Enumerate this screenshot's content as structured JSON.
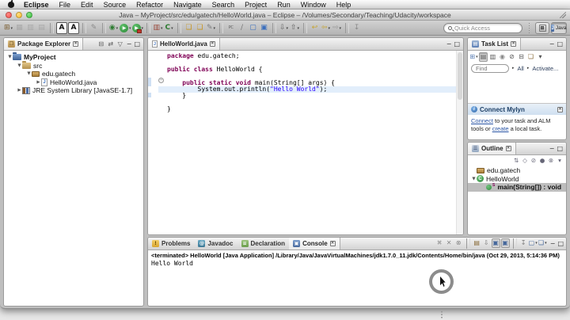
{
  "ui": {
    "close_glyph": "✕",
    "min_glyph": "−",
    "max_glyph": "□",
    "dd_glyph": "▾",
    "tri_glyph": "▸",
    "fold_minus": "−"
  },
  "menu_bar": {
    "items": [
      {
        "label": "Eclipse",
        "bold": true
      },
      {
        "label": "File"
      },
      {
        "label": "Edit"
      },
      {
        "label": "Source"
      },
      {
        "label": "Refactor"
      },
      {
        "label": "Navigate"
      },
      {
        "label": "Search"
      },
      {
        "label": "Project"
      },
      {
        "label": "Run"
      },
      {
        "label": "Window"
      },
      {
        "label": "Help"
      }
    ]
  },
  "titlebar": {
    "title": "Java – MyProject/src/edu/gatech/HelloWorld.java – Eclipse – /Volumes/Secondary/Teaching/Udacity/workspace"
  },
  "toolbar": {
    "quick_access_placeholder": "Quick Access",
    "perspective_label": "Java",
    "perspective_icon_letter": "J",
    "open_perspective_glyph": "⊞",
    "icons": [
      {
        "name": "new-wizard-icon",
        "glyph": "⊞",
        "c": "#7a5c2e",
        "dd": true
      },
      {
        "name": "save-icon",
        "glyph": "▦",
        "c": "#a8a8a8"
      },
      {
        "name": "save-all-icon",
        "glyph": "▥",
        "c": "#a8a8a8"
      },
      {
        "name": "print-icon",
        "glyph": "▤",
        "c": "#a8a8a8"
      },
      {
        "sep": true
      },
      {
        "name": "font-decrease-icon",
        "glyph": "A",
        "style": "boxed"
      },
      {
        "name": "font-increase-icon",
        "glyph": "A",
        "style": "boxed"
      },
      {
        "sep": true
      },
      {
        "name": "skip-breakpoints-icon",
        "glyph": "✎",
        "c": "#8a8a8a"
      },
      {
        "sep": true
      },
      {
        "name": "debug-icon",
        "glyph": "◉",
        "c": "#2e7d32",
        "dd": true
      },
      {
        "name": "run-icon",
        "glyph": "▶",
        "style": "green-circle",
        "dd": true
      },
      {
        "name": "external-tools-icon",
        "glyph": "▶",
        "style": "green-circle-red",
        "dd": true
      },
      {
        "sep": true
      },
      {
        "name": "coverage-icon",
        "glyph": "▥",
        "c": "#9c4a3c",
        "dd": true
      },
      {
        "name": "checkout-icon",
        "glyph": "C",
        "c": "#2e7d32",
        "style": "bold",
        "dd": true
      },
      {
        "sep": true
      },
      {
        "name": "open-folder-icon",
        "glyph": "❏",
        "c": "#c8951f"
      },
      {
        "name": "open-folder-alt-icon",
        "glyph": "❏",
        "c": "#c8951f"
      },
      {
        "name": "new-java-element-icon",
        "glyph": "✎",
        "c": "#7d7d7d",
        "dd": true
      },
      {
        "sep": true
      },
      {
        "name": "pc-icon",
        "glyph": "PC",
        "c": "#666666",
        "style": "small"
      },
      {
        "name": "mark-occurrences-icon",
        "glyph": "∕",
        "c": "#777777"
      },
      {
        "name": "open-type-icon",
        "glyph": "▢",
        "c": "#3b6fbd"
      },
      {
        "name": "open-task-icon",
        "glyph": "▣",
        "c": "#3b6fbd"
      },
      {
        "sep": true
      },
      {
        "name": "next-annotation-icon",
        "glyph": "⇩",
        "c": "#666666",
        "dd": true
      },
      {
        "name": "previous-annotation-icon",
        "glyph": "⇧",
        "c": "#666666",
        "dd": true
      },
      {
        "sep": true
      },
      {
        "name": "last-edit-location-icon",
        "glyph": "↩",
        "c": "#c7a42e"
      },
      {
        "name": "back-icon",
        "glyph": "⇦",
        "c": "#c7a42e",
        "dd": true
      },
      {
        "name": "forward-icon",
        "glyph": "⇨",
        "c": "#9a9a9a",
        "dd": true
      },
      {
        "sep": true
      },
      {
        "name": "pin-editor-icon",
        "glyph": "↧",
        "c": "#8a8a8a"
      }
    ]
  },
  "package_explorer": {
    "title": "Package Explorer",
    "toolbar": [
      {
        "name": "collapse-all-icon",
        "glyph": "⊟"
      },
      {
        "name": "link-with-editor-icon",
        "glyph": "⇄"
      },
      {
        "name": "view-menu-icon",
        "glyph": "▽"
      }
    ],
    "tree": [
      {
        "label": "MyProject",
        "icon": "project",
        "arrow": "down",
        "indent": 0,
        "bold": true
      },
      {
        "label": "src",
        "icon": "src-folder",
        "arrow": "down",
        "indent": 1
      },
      {
        "label": "edu.gatech",
        "icon": "package",
        "arrow": "down",
        "indent": 2
      },
      {
        "label": "HelloWorld.java",
        "icon": "java-file",
        "arrow": "right",
        "indent": 3
      },
      {
        "label": "JRE System Library [JavaSE-1.7]",
        "icon": "library",
        "arrow": "right",
        "indent": 1
      }
    ]
  },
  "editor": {
    "tab": "HelloWorld.java",
    "lines": [
      {
        "tokens": [
          [
            "kw",
            "package"
          ],
          [
            "pl",
            " edu.gatech;"
          ]
        ]
      },
      {
        "tokens": []
      },
      {
        "tokens": [
          [
            "kw",
            "public"
          ],
          [
            "pl",
            " "
          ],
          [
            "kw",
            "class"
          ],
          [
            "pl",
            " HelloWorld {"
          ]
        ]
      },
      {
        "tokens": []
      },
      {
        "tokens": [
          [
            "pl",
            "    "
          ],
          [
            "kw",
            "public"
          ],
          [
            "pl",
            " "
          ],
          [
            "kw",
            "static"
          ],
          [
            "pl",
            " "
          ],
          [
            "kw",
            "void"
          ],
          [
            "pl",
            " main(String[] args) {"
          ]
        ],
        "fold": true
      },
      {
        "tokens": [
          [
            "pl",
            "        System.out.println("
          ],
          [
            "str",
            "\"Hello World\""
          ],
          [
            "pl",
            ");"
          ]
        ],
        "highlight": true
      },
      {
        "tokens": [
          [
            "pl",
            "    }"
          ]
        ]
      },
      {
        "tokens": []
      },
      {
        "tokens": [
          [
            "pl",
            "}"
          ]
        ]
      }
    ]
  },
  "task_list": {
    "title": "Task List",
    "toolbar": [
      {
        "name": "new-task-icon",
        "glyph": "⊞",
        "c": "#5b7fb5",
        "dd": true
      },
      {
        "name": "categorized-presentation-icon",
        "glyph": "▤",
        "pressed": true
      },
      {
        "name": "scheduled-presentation-icon",
        "glyph": "▥"
      },
      {
        "name": "focus-on-workweek-icon",
        "glyph": "◉",
        "c": "#888888"
      },
      {
        "name": "filter-completed-icon",
        "glyph": "⊘"
      },
      {
        "name": "collapse-all-icon",
        "glyph": "⊟"
      },
      {
        "name": "task-repositories-icon",
        "glyph": "❏",
        "c": "#8a6d3b"
      },
      {
        "name": "view-menu-icon",
        "glyph": "▾"
      }
    ],
    "find_placeholder": "Find",
    "all_label": "All",
    "activate_label": "Activate...",
    "mylyn": {
      "title": "Connect Mylyn",
      "body_parts": [
        {
          "t": "Connect",
          "link": true
        },
        {
          "t": " to your task and ALM tools or "
        },
        {
          "t": "create",
          "link": true
        },
        {
          "t": " a local task."
        }
      ]
    }
  },
  "outline": {
    "title": "Outline",
    "toolbar": [
      {
        "name": "sort-icon",
        "glyph": "⇅"
      },
      {
        "name": "hide-fields-icon",
        "glyph": "◇"
      },
      {
        "name": "hide-static-members-icon",
        "glyph": "⊘"
      },
      {
        "name": "hide-non-public-members-icon",
        "glyph": "●"
      },
      {
        "name": "hide-local-types-icon",
        "glyph": "⊗"
      },
      {
        "name": "view-menu-icon",
        "glyph": "▾"
      }
    ],
    "items": [
      {
        "label": "edu.gatech",
        "icon": "package",
        "indent": 0
      },
      {
        "label": "HelloWorld",
        "icon": "class",
        "arrow": "down",
        "indent": 0
      },
      {
        "label": "main(String[]) : void",
        "icon": "method",
        "indent": 1,
        "selected": true,
        "modifier": "S",
        "bold": true
      }
    ]
  },
  "console": {
    "tabs": [
      {
        "label": "Problems",
        "icon": "problems"
      },
      {
        "label": "Javadoc",
        "icon": "javadoc"
      },
      {
        "label": "Declaration",
        "icon": "declaration"
      },
      {
        "label": "Console",
        "icon": "console",
        "active": true
      }
    ],
    "toolbar": [
      {
        "name": "terminate-icon",
        "glyph": "✖",
        "c": "#aaaaaa"
      },
      {
        "name": "remove-launch-icon",
        "glyph": "✕",
        "c": "#888888"
      },
      {
        "name": "remove-all-terminated-icon",
        "glyph": "⊗",
        "c": "#888888"
      },
      {
        "sep": true
      },
      {
        "name": "clear-console-icon",
        "glyph": "▤",
        "c": "#8a6d3b"
      },
      {
        "name": "scroll-lock-icon",
        "glyph": "⇩",
        "c": "#777777"
      },
      {
        "name": "show-stdout-icon",
        "glyph": "▣",
        "c": "#46689c",
        "pressed": true
      },
      {
        "name": "show-stderr-icon",
        "glyph": "▣",
        "c": "#46689c",
        "pressed": true
      },
      {
        "sep": true
      },
      {
        "name": "pin-console-icon",
        "glyph": "↧",
        "c": "#777777"
      },
      {
        "name": "display-console-icon",
        "glyph": "▢",
        "c": "#46689c",
        "dd": true
      },
      {
        "name": "open-console-icon",
        "glyph": "❏",
        "c": "#46689c",
        "dd": true
      }
    ],
    "status": "<terminated> HelloWorld [Java Application] /Library/Java/JavaVirtualMachines/jdk1.7.0_11.jdk/Contents/Home/bin/java (Oct 29, 2013, 5:14:36 PM)",
    "output": "Hello World"
  }
}
